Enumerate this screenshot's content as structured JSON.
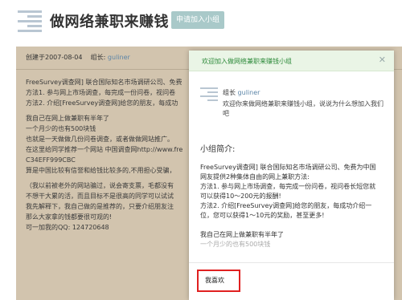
{
  "header": {
    "logo_icon": "group-logo-icon",
    "title": "做网络兼职来赚钱",
    "join_label": "申请加入小组",
    "join_color": "#a9c9c9"
  },
  "post": {
    "created": "创建于2007-08-04",
    "owner_label": "组长:",
    "owner_name": "guliner",
    "lines": [
      "FreeSurvey调查网] 联合国际知名市场调研公司、免费",
      "方法1. 参与网上市场调查，每完成一份问卷，视问卷",
      "方法2. 介绍[FreeSurvey调查网]给您的朋友，每成功",
      "我自己在网上做兼职有半年了",
      "一个月少的也有500块钱",
      "也就是一天做做几份问卷调查，或者做做网站推广。",
      "在这里给同学推荐一个网站 中国调查网http://www.fre",
      "C34EFF999CBC",
      "算是中国比较有信誉和给钱比较多的,不用担心受骗，",
      "（我以前被老外的网站骗过，说会寄支票，毛都没有",
      "不想干大累的活，而且目标不是很高的同学可以试试",
      "我先解释下，我自己做的是推荐的，只要介绍朋友注",
      "那么大家拿的钱都要很可观的!",
      "可一加我的QQ: 124720648"
    ]
  },
  "modal": {
    "title": "欢迎加入做网络兼职来赚钱小组",
    "close_icon": "close-icon",
    "owner_label": "组长",
    "owner_name": "guliner",
    "welcome": "欢迎你来做网络兼职来赚钱小组，说说为什么想加入我们吧",
    "intro_heading": "小组简介:",
    "intro_lines": [
      "FreeSurvey调查网] 联合国际知名市场调研公司、免费为中国",
      "网友提供2种集体自由的网上兼职方法:",
      "方法1. 参与网上市场调查，每完成一份问卷，视问卷长短您就",
      "可以获得10～200元的报酬!",
      "方法2. 介绍[FreeSurvey调查网]给您的朋友，每成功介绍一",
      "位，您可以获得1～10元的奖励，甚至更多!",
      "我自己在网上做兼职有半年了",
      "一个月少的也有500块钱"
    ],
    "reply_value": "我喜欢"
  },
  "colors": {
    "overlay": "#d2c4ae",
    "modal_header": "#eaf5e6",
    "modal_title": "#2d8a3a",
    "link": "#5d86a8",
    "highlight": "#e02020"
  }
}
